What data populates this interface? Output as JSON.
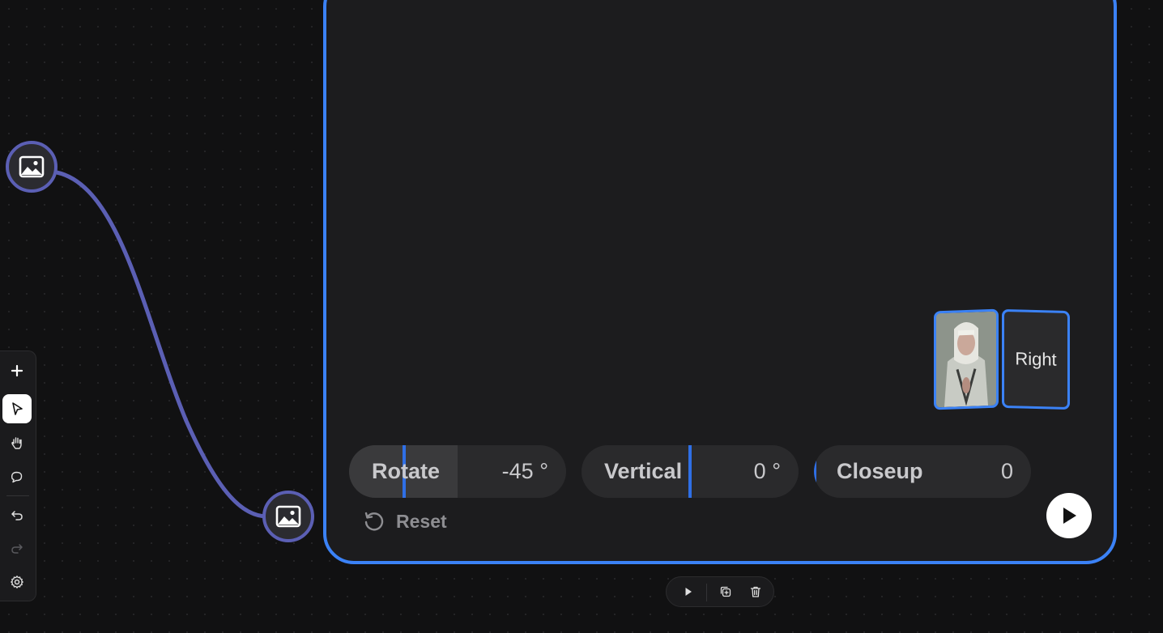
{
  "canvas": {
    "edge_color": "#5b5fb4",
    "accent_color": "#3b82f6",
    "annotation_arrow_color": "#ef4136"
  },
  "nodes": {
    "source_icon": "image-icon",
    "target_icon": "image-icon"
  },
  "camera_panel": {
    "cube": {
      "face_left_content": "portrait-thumbnail",
      "face_right_label": "Right"
    },
    "sliders": [
      {
        "label": "Rotate",
        "value": "-45 °",
        "fill_fraction": 0.25
      },
      {
        "label": "Vertical",
        "value": "0 °",
        "fill_fraction": 0.5
      },
      {
        "label": "Closeup",
        "value": "0",
        "fill_fraction": 0.0
      }
    ],
    "reset_label": "Reset",
    "play_icon": "play-icon"
  },
  "left_toolbar": {
    "tools": [
      "plus-icon",
      "pointer-icon",
      "hand-icon",
      "chat-icon",
      "undo-icon",
      "redo-icon",
      "gear-icon"
    ],
    "active_tool": "pointer-icon"
  },
  "node_actions": {
    "icons": [
      "play-icon",
      "duplicate-icon",
      "trash-icon"
    ]
  }
}
